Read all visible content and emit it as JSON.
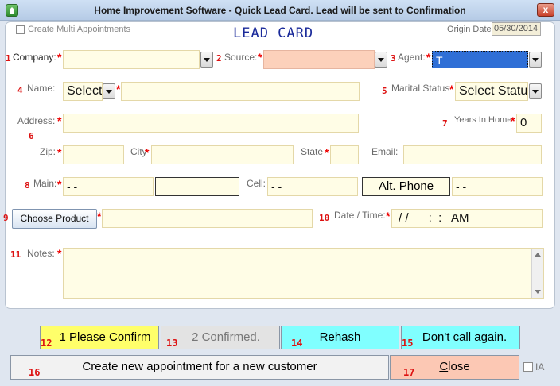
{
  "window": {
    "title": "Home Improvement Software - Quick Lead Card.  Lead will be sent to Confirmation",
    "close_glyph": "x"
  },
  "header": {
    "create_multi_label": "Create Multi Appointments",
    "card_title": "LEAD CARD",
    "origin_date_label": "Origin Date:",
    "origin_date_value": "05/30/2014"
  },
  "field_numbers": [
    "1",
    "2",
    "3",
    "4",
    "5",
    "6",
    "7",
    "8",
    "9",
    "10",
    "11",
    "12",
    "13",
    "14",
    "15",
    "16",
    "17"
  ],
  "required_mark": "*",
  "fields": {
    "company": {
      "label": "Company:"
    },
    "source": {
      "label": "Source:"
    },
    "agent": {
      "label": "Agent:",
      "value": "T"
    },
    "name": {
      "label": "Name:",
      "prefix_value": "Select"
    },
    "marital": {
      "label": "Marital Status",
      "value": "Select Status"
    },
    "address": {
      "label": "Address:"
    },
    "years": {
      "label": "Years In Home",
      "value": "0"
    },
    "zip": {
      "label": "Zip:"
    },
    "city": {
      "label": "City"
    },
    "state": {
      "label": "State"
    },
    "email": {
      "label": "Email:"
    },
    "main": {
      "label": "Main:",
      "value": " -  -"
    },
    "cell": {
      "label": "Cell:",
      "value": " -  -"
    },
    "alt_phone": {
      "label": "Alt. Phone",
      "value": " -  -"
    },
    "product": {
      "button": "Choose Product"
    },
    "datetime": {
      "label": "Date / Time:",
      "value": " / /      :  :   AM"
    },
    "notes": {
      "label": "Notes:"
    }
  },
  "actions": {
    "please_confirm": {
      "hotkey": "1",
      "label": " Please Confirm"
    },
    "confirmed": {
      "hotkey": "2",
      "label": " Confirmed."
    },
    "rehash": "Rehash",
    "dont_call": "Don't call again.",
    "new_customer": "Create new appointment for a new customer",
    "close": {
      "hotkey": "C",
      "label": "lose"
    },
    "ia_label": "IA"
  },
  "colors": {
    "field_bg": "#fffde6",
    "source_bg": "#fcd1bb",
    "agent_highlight": "#2f6fd6",
    "confirm_bg": "#ffff6a",
    "rehash_bg": "#80ffff",
    "close_bg": "#fcc8b4",
    "required": "#e00000",
    "number": "#d11111"
  }
}
